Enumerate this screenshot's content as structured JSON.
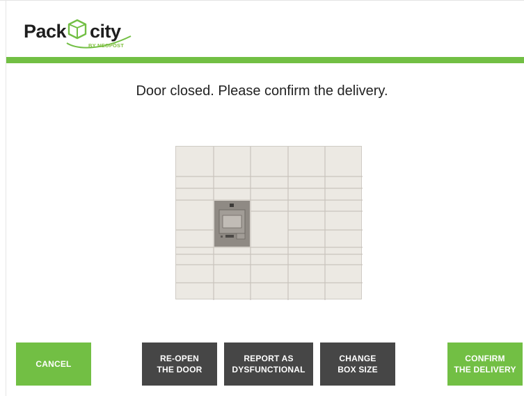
{
  "brand": {
    "name_part1": "Pack",
    "name_part2": "city",
    "tagline": "BY NEOPOST",
    "logo_icon": "package-cube-icon",
    "accent_color": "#72bf44"
  },
  "main": {
    "message": "Door closed. Please confirm the delivery."
  },
  "locker": {
    "illustration": "locker-bank-grid",
    "terminal_color": "#8f8a84",
    "door_color": "#ece9e3"
  },
  "buttons": {
    "cancel": "CANCEL",
    "reopen_line1": "RE-OPEN",
    "reopen_line2": "THE DOOR",
    "report_line1": "REPORT AS",
    "report_line2": "DYSFUNCTIONAL",
    "change_line1": "CHANGE",
    "change_line2": "BOX SIZE",
    "confirm_line1": "CONFIRM",
    "confirm_line2": "THE DELIVERY"
  },
  "colors": {
    "green": "#72bf44",
    "dark_gray": "#464646"
  }
}
